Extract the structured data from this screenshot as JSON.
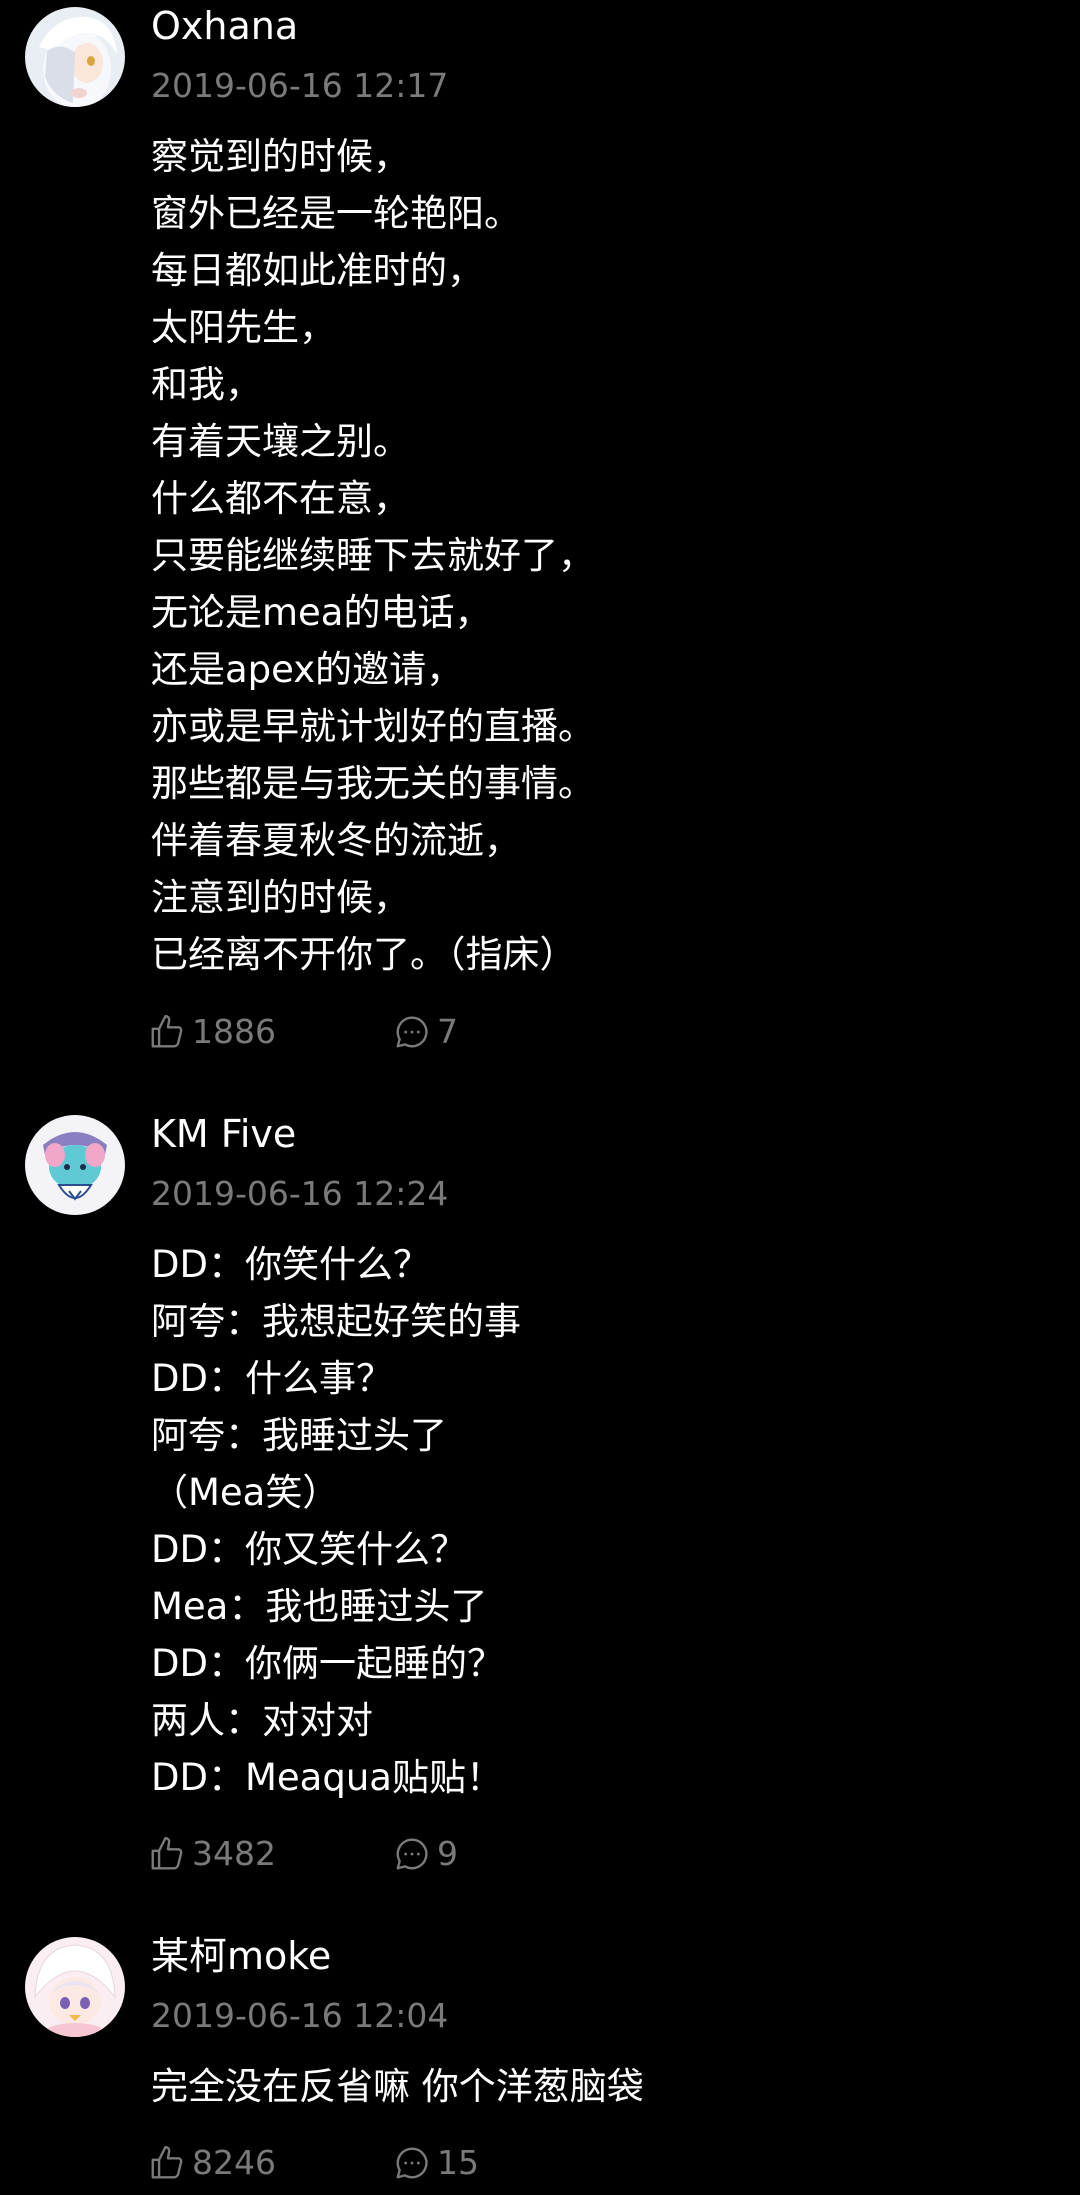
{
  "theme": {
    "background": "#000000",
    "text": "#ffffff",
    "muted": "#7a7a7a"
  },
  "comments": [
    {
      "username": "Oxhana",
      "timestamp": "2019-06-16 12:17",
      "avatar": "avatar-icon",
      "lines": [
        "察觉到的时候，",
        "窗外已经是一轮艳阳。",
        "每日都如此准时的，",
        "太阳先生，",
        "和我，",
        "有着天壤之别。",
        "什么都不在意，",
        "只要能继续睡下去就好了，",
        "无论是mea的电话，",
        "还是apex的邀请，",
        "亦或是早就计划好的直播。",
        "那些都是与我无关的事情。",
        "伴着春夏秋冬的流逝，",
        "注意到的时候，",
        "已经离不开你了。（指床）"
      ],
      "likes": "1886",
      "replies": "7"
    },
    {
      "username": "KM Five",
      "timestamp": "2019-06-16 12:24",
      "avatar": "avatar-icon",
      "lines": [
        "DD：你笑什么？",
        "阿夸：我想起好笑的事",
        "DD：什么事？",
        "阿夸：我睡过头了",
        "（Mea笑）",
        "DD：你又笑什么？",
        "Mea：我也睡过头了",
        "DD：你俩一起睡的？",
        "两人：对对对",
        "DD：Meaqua贴贴！"
      ],
      "likes": "3482",
      "replies": "9"
    },
    {
      "username": "某柯moke",
      "timestamp": "2019-06-16 12:04",
      "avatar": "avatar-icon",
      "lines": [
        "完全没在反省嘛 你个洋葱脑袋"
      ],
      "likes": "8246",
      "replies": "15"
    }
  ],
  "icons": {
    "like": "thumbs-up-icon",
    "reply": "speech-bubble-icon"
  }
}
